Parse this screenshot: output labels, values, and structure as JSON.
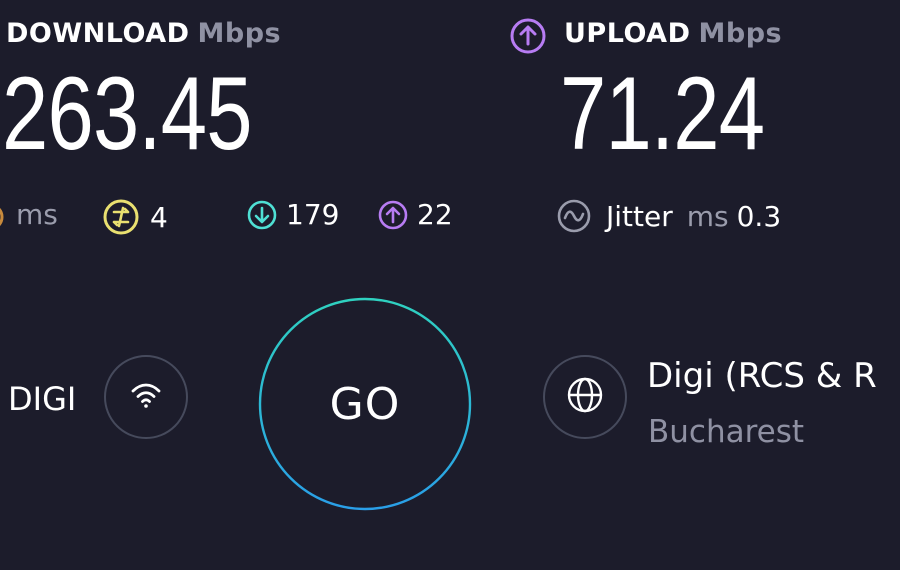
{
  "download": {
    "label": "DOWNLOAD",
    "unit": "Mbps",
    "value": "263.45"
  },
  "upload": {
    "label": "UPLOAD",
    "unit": "Mbps",
    "value": "71.24",
    "icon": "upload-arrow-icon"
  },
  "latency": {
    "unit": "ms",
    "idle": "4",
    "download": "179",
    "upload": "22",
    "icons": [
      "ping-icon",
      "download-arrow-icon",
      "upload-arrow-icon"
    ]
  },
  "jitter": {
    "label": "Jitter",
    "unit": "ms",
    "value": "0.3",
    "icon": "jitter-wave-icon"
  },
  "isp": {
    "name": "DIGI",
    "icon": "wifi-icon"
  },
  "go_button": {
    "label": "GO"
  },
  "server": {
    "name": "Digi (RCS & R",
    "location": "Bucharest",
    "icon": "globe-icon"
  },
  "colors": {
    "background": "#1c1c2b",
    "ping_yellow": "#e9e070",
    "download_teal": "#4fe0d4",
    "upload_purple": "#b77cf3",
    "ring_gray": "#464a5c",
    "go_ring_top": "#2fd1c0",
    "go_ring_bottom": "#2a9fe8",
    "muted_text": "#8f91a3"
  }
}
